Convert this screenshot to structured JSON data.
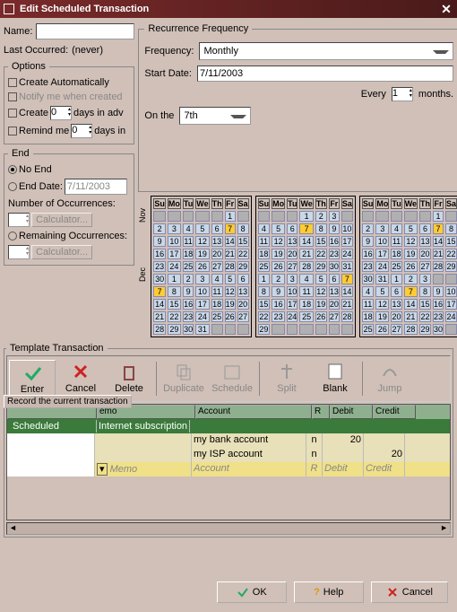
{
  "title": "Edit Scheduled Transaction",
  "name_label": "Name:",
  "name_value": "",
  "last_occurred_label": "Last Occurred:",
  "last_occurred_value": "(never)",
  "options": {
    "legend": "Options",
    "create_auto": "Create Automatically",
    "notify": "Notify me when created",
    "create_label": "Create",
    "create_days": "0",
    "days_in_adv": "days in adv",
    "remind_label": "Remind me",
    "remind_days": "0",
    "days_in": "days in"
  },
  "end": {
    "legend": "End",
    "no_end": "No End",
    "end_date_label": "End Date:",
    "end_date_value": "7/11/2003",
    "num_occ": "Number of Occurrences:",
    "rem_occ": "Remaining Occurrences:",
    "calc": "Calculator..."
  },
  "recurrence": {
    "legend": "Recurrence Frequency",
    "freq_label": "Frequency:",
    "freq_value": "Monthly",
    "start_label": "Start Date:",
    "start_value": "7/11/2003",
    "every_label": "Every",
    "every_value": "1",
    "every_unit": "months.",
    "on_label": "On the",
    "on_value": "7th"
  },
  "day_headers": [
    "Su",
    "Mo",
    "Tu",
    "We",
    "Th",
    "Fr",
    "Sa"
  ],
  "month_labels": [
    "Nov",
    "Dec"
  ],
  "cal1_rows": [
    [
      "",
      "",
      "",
      "",
      "",
      "1"
    ],
    [
      2,
      3,
      4,
      5,
      6,
      "7h",
      8
    ],
    [
      9,
      10,
      11,
      12,
      13,
      14,
      15
    ],
    [
      16,
      17,
      18,
      19,
      20,
      21,
      22
    ],
    [
      23,
      24,
      25,
      26,
      27,
      28,
      29
    ],
    [
      30,
      1,
      2,
      3,
      4,
      5,
      6
    ],
    [
      "7h",
      8,
      9,
      10,
      11,
      12,
      13
    ],
    [
      14,
      15,
      16,
      17,
      18,
      19,
      20
    ],
    [
      21,
      22,
      23,
      24,
      25,
      26,
      27
    ],
    [
      28,
      29,
      30,
      31,
      "",
      "",
      ""
    ]
  ],
  "cal2_rows": [
    [
      "",
      "",
      "",
      "1",
      2,
      3
    ],
    [
      4,
      5,
      6,
      "7h",
      8,
      9,
      10
    ],
    [
      11,
      12,
      13,
      14,
      15,
      16,
      17
    ],
    [
      18,
      19,
      20,
      21,
      22,
      23,
      24
    ],
    [
      25,
      26,
      27,
      28,
      29,
      30,
      31
    ],
    [
      1,
      2,
      3,
      4,
      5,
      6,
      "7h"
    ],
    [
      8,
      9,
      10,
      11,
      12,
      13,
      14
    ],
    [
      15,
      16,
      17,
      18,
      19,
      20,
      21
    ],
    [
      22,
      23,
      24,
      25,
      26,
      27,
      28
    ],
    [
      29,
      "",
      "",
      "",
      "",
      "",
      ""
    ]
  ],
  "cal3_rows": [
    [
      "",
      "",
      "",
      "",
      "",
      1
    ],
    [
      2,
      3,
      4,
      5,
      6,
      "7h",
      8
    ],
    [
      9,
      10,
      11,
      12,
      13,
      14,
      15
    ],
    [
      16,
      17,
      18,
      19,
      20,
      21,
      22
    ],
    [
      23,
      24,
      25,
      26,
      27,
      28,
      29
    ],
    [
      30,
      31,
      1,
      2,
      3
    ],
    [
      4,
      5,
      6,
      "7h",
      8,
      9,
      10
    ],
    [
      11,
      12,
      13,
      14,
      15,
      16,
      17
    ],
    [
      18,
      19,
      20,
      21,
      22,
      23,
      24
    ],
    [
      25,
      26,
      27,
      28,
      29,
      30,
      ""
    ]
  ],
  "template": {
    "legend": "Template Transaction",
    "buttons": [
      "Enter",
      "Cancel",
      "Delete",
      "Duplicate",
      "Schedule",
      "Split",
      "Blank",
      "Jump"
    ],
    "tooltip": "Record the current transaction",
    "headers": {
      "date": "",
      "memo": "emo",
      "account": "Account",
      "r": "R",
      "debit": "Debit",
      "credit": "Credit"
    },
    "row0": {
      "date": "Scheduled",
      "desc": "Internet subscription"
    },
    "row1": {
      "account": "my bank account",
      "r": "n",
      "debit": "20"
    },
    "row2": {
      "account": "my ISP account",
      "r": "n",
      "credit": "20"
    },
    "placeholder": {
      "memo": "Memo",
      "account": "Account",
      "r": "R",
      "debit": "Debit",
      "credit": "Credit"
    }
  },
  "footer": {
    "ok": "OK",
    "help": "Help",
    "cancel": "Cancel"
  }
}
